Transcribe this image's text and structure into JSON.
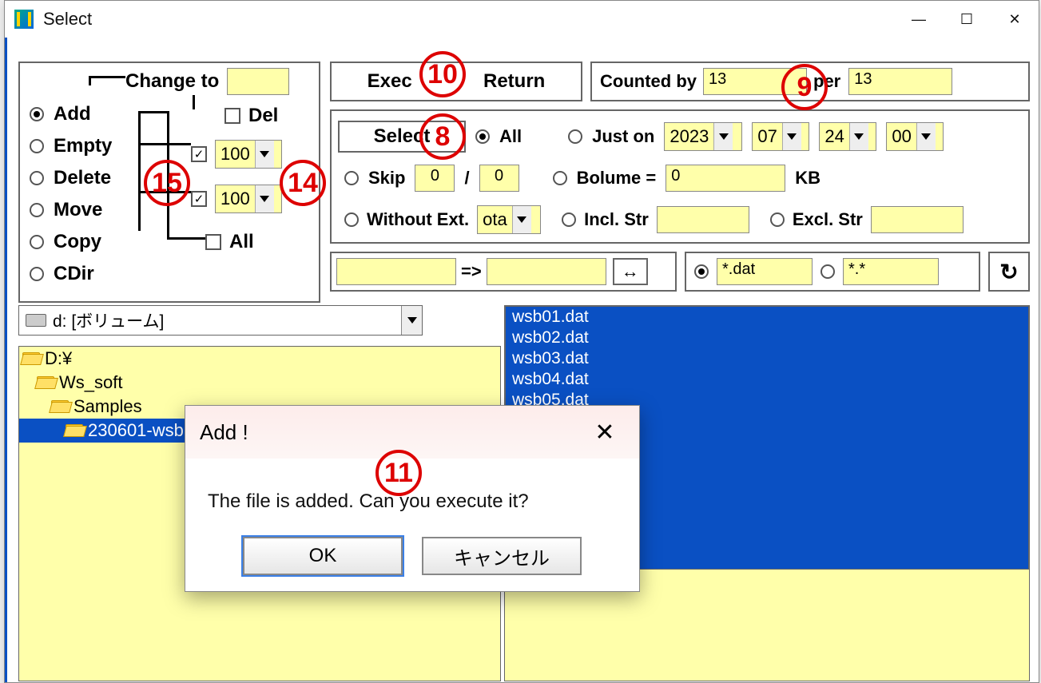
{
  "window": {
    "title": "Select"
  },
  "changeTo": {
    "label": "Change to",
    "value": "",
    "modes": [
      {
        "key": "add",
        "label": "Add",
        "selected": true
      },
      {
        "key": "empty",
        "label": "Empty",
        "selected": false
      },
      {
        "key": "delete",
        "label": "Delete",
        "selected": false
      },
      {
        "key": "move",
        "label": "Move",
        "selected": false
      },
      {
        "key": "copy",
        "label": "Copy",
        "selected": false
      },
      {
        "key": "cdir",
        "label": "CDir",
        "selected": false
      }
    ],
    "del": {
      "label": "Del",
      "checked": false
    },
    "check1": {
      "checked": true,
      "value": "100"
    },
    "check2": {
      "checked": true,
      "value": "100"
    },
    "all": {
      "label": "All",
      "checked": false
    }
  },
  "top": {
    "exec": "Exec",
    "return": "Return",
    "countedBy": "Counted by",
    "countedVal": "13",
    "per": "per",
    "perVal": "13",
    "selectBtn": "Select",
    "allLabel": "All",
    "justOn": "Just on",
    "date": {
      "y": "2023",
      "m": "07",
      "d": "24",
      "h": "00"
    },
    "skip": "Skip",
    "skipA": "0",
    "skipSep": "/",
    "skipB": "0",
    "bolume": "Bolume  =",
    "bolumeVal": "0",
    "kb": "KB",
    "without": "Without Ext.",
    "withoutVal": "ota",
    "incl": "Incl. Str",
    "inclVal": "",
    "excl": "Excl. Str",
    "exclVal": "",
    "mapFrom": "",
    "mapArrow": "=>",
    "mapTo": "",
    "swap": "↔",
    "ext1": "*.dat",
    "ext2": "*.*",
    "reload": "↻"
  },
  "drive": "d: [ボリューム]",
  "tree": [
    {
      "indent": 0,
      "label": "D:¥",
      "selected": false
    },
    {
      "indent": 1,
      "label": "Ws_soft",
      "selected": false
    },
    {
      "indent": 2,
      "label": "Samples",
      "selected": false
    },
    {
      "indent": 3,
      "label": "230601-wsb",
      "selected": true
    }
  ],
  "files": [
    "wsb01.dat",
    "wsb02.dat",
    "wsb03.dat",
    "wsb04.dat",
    "wsb05.dat"
  ],
  "dialog": {
    "title": "Add !",
    "body": "The file is added. Can you execute it?",
    "ok": "OK",
    "cancel": "キャンセル"
  },
  "annotations": {
    "a8": "8",
    "a9": "9",
    "a10": "10",
    "a11": "11",
    "a14": "14",
    "a15": "15"
  }
}
